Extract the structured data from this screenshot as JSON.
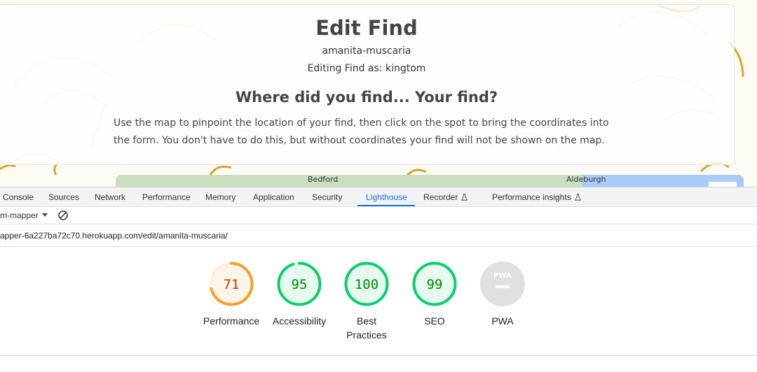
{
  "page": {
    "title": "Edit Find",
    "slug": "amanita-muscaria",
    "editing_as": "Editing Find as: kingtom",
    "subheading": "Where did you find... Your find?",
    "instructions": "Use the map to pinpoint the location of your find, then click on the spot to bring the coordinates into the form. You don't have to do this, but without coordinates your find will not be shown on the map.",
    "map_labels": [
      "Bedford",
      "Aldeburgh"
    ]
  },
  "devtools": {
    "tabs": [
      {
        "label": "Console",
        "active": false
      },
      {
        "label": "Sources",
        "active": false
      },
      {
        "label": "Network",
        "active": false
      },
      {
        "label": "Performance",
        "active": false
      },
      {
        "label": "Memory",
        "active": false
      },
      {
        "label": "Application",
        "active": false
      },
      {
        "label": "Security",
        "active": false
      },
      {
        "label": "Lighthouse",
        "active": true
      },
      {
        "label": "Recorder",
        "active": false,
        "icon": "flask-icon"
      },
      {
        "label": "Performance insights",
        "active": false,
        "icon": "flask-icon"
      }
    ],
    "target_name": "m-mapper",
    "clear_icon": "block-icon",
    "report_url": "apper-6a227ba72c70.herokuapp.com/edit/amanita-muscaria/"
  },
  "lighthouse": {
    "colors": {
      "average": "#fa9f28",
      "average_text": "#c33300",
      "pass": "#0cce6b",
      "pass_text": "#008800",
      "na": "#e0e0e0"
    },
    "scores": [
      {
        "label": "Performance",
        "value": "71",
        "fraction": 0.71,
        "status": "average"
      },
      {
        "label": "Accessibility",
        "value": "95",
        "fraction": 0.95,
        "status": "pass"
      },
      {
        "label": "Best Practices",
        "value": "100",
        "fraction": 1.0,
        "status": "pass"
      },
      {
        "label": "SEO",
        "value": "99",
        "fraction": 0.99,
        "status": "pass"
      },
      {
        "label": "PWA",
        "value": "PWA",
        "fraction": 0,
        "status": "na"
      }
    ]
  }
}
